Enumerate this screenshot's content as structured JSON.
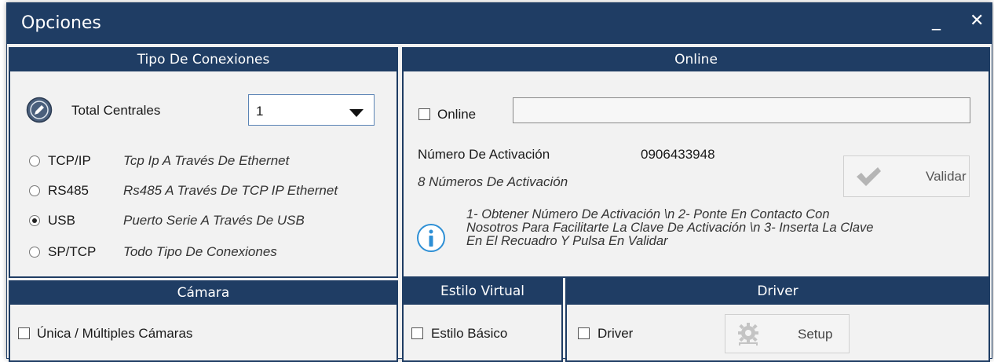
{
  "window": {
    "title": "Opciones",
    "minimize": "_",
    "close": "✕"
  },
  "conexiones": {
    "header": "Tipo De Conexiones",
    "total_label": "Total Centrales",
    "total_value": "1",
    "options": [
      {
        "label": "TCP/IP",
        "desc": "Tcp Ip A Través De Ethernet",
        "selected": false
      },
      {
        "label": "RS485",
        "desc": "Rs485 A Través De TCP IP Ethernet",
        "selected": false
      },
      {
        "label": "USB",
        "desc": "Puerto Serie A Través De USB",
        "selected": true
      },
      {
        "label": "SP/TCP",
        "desc": "Todo Tipo De Conexiones",
        "selected": false
      }
    ]
  },
  "online": {
    "header": "Online",
    "checkbox_label": "Online",
    "checked": false,
    "field_value": "",
    "activation_label": "Número De Activación",
    "activation_value": "0906433948",
    "activation_hint": "8 Números De Activación",
    "validate_label": "Validar",
    "info_line1": "1- Obtener Número De Activación \\n  2- Ponte En Contacto Con",
    "info_line2": "Nosotros Para Facilitarte La Clave De Activación \\n 3- Inserta La Clave",
    "info_line3": "En El Recuadro Y Pulsa En Validar"
  },
  "camara": {
    "header": "Cámara",
    "checkbox_label": "Única / Múltiples Cámaras",
    "checked": false
  },
  "estilo": {
    "header": "Estilo Virtual",
    "checkbox_label": "Estilo Básico",
    "checked": false
  },
  "driver": {
    "header": "Driver",
    "checkbox_label": "Driver",
    "checked": false,
    "setup_label": "Setup"
  },
  "colors": {
    "header_bg": "#1f3d64",
    "panel_bg": "#f2f2f2",
    "info_icon": "#2d8fd5"
  }
}
